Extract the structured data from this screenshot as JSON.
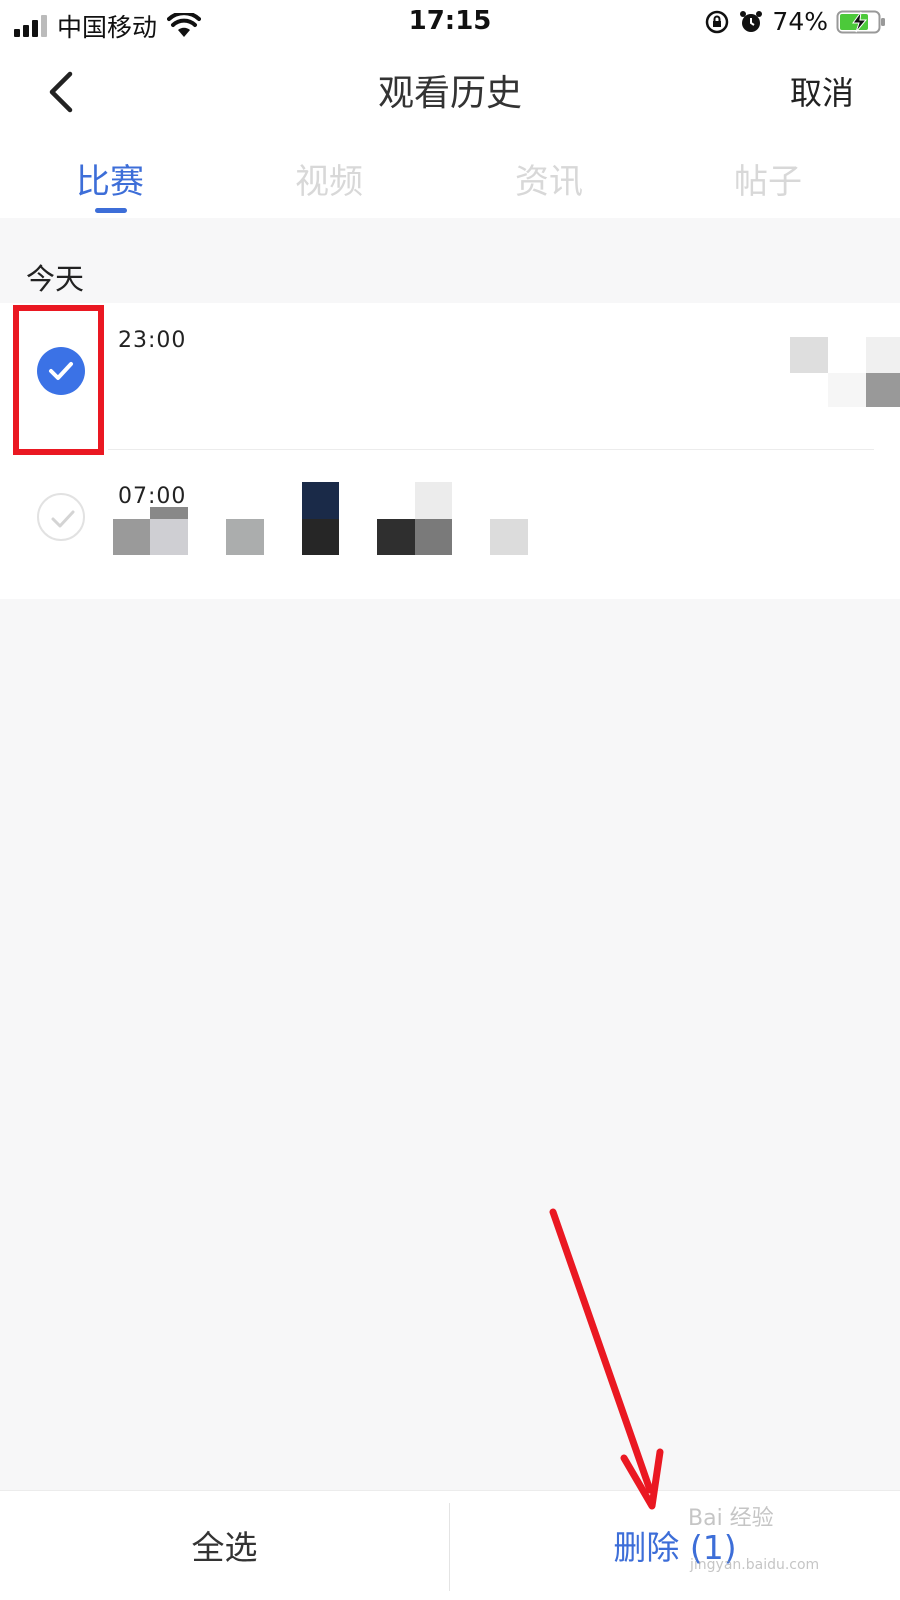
{
  "status_bar": {
    "carrier": "中国移动",
    "time": "17:15",
    "battery_percent": "74%"
  },
  "nav": {
    "title": "观看历史",
    "cancel_label": "取消"
  },
  "tabs": [
    {
      "label": "比赛",
      "active": true
    },
    {
      "label": "视频",
      "active": false
    },
    {
      "label": "资讯",
      "active": false
    },
    {
      "label": "帖子",
      "active": false
    }
  ],
  "section": {
    "label": "今天"
  },
  "rows": [
    {
      "time": "23:00",
      "checked": true
    },
    {
      "time": "07:00",
      "checked": false
    }
  ],
  "bottom_bar": {
    "select_all_label": "全选",
    "delete_label": "删除 (1)"
  },
  "watermark": {
    "text": "Bai 经验",
    "url_text": "jingyan.baidu.com"
  },
  "colors": {
    "accent": "#3d6ed8",
    "highlight": "#ea1822"
  }
}
